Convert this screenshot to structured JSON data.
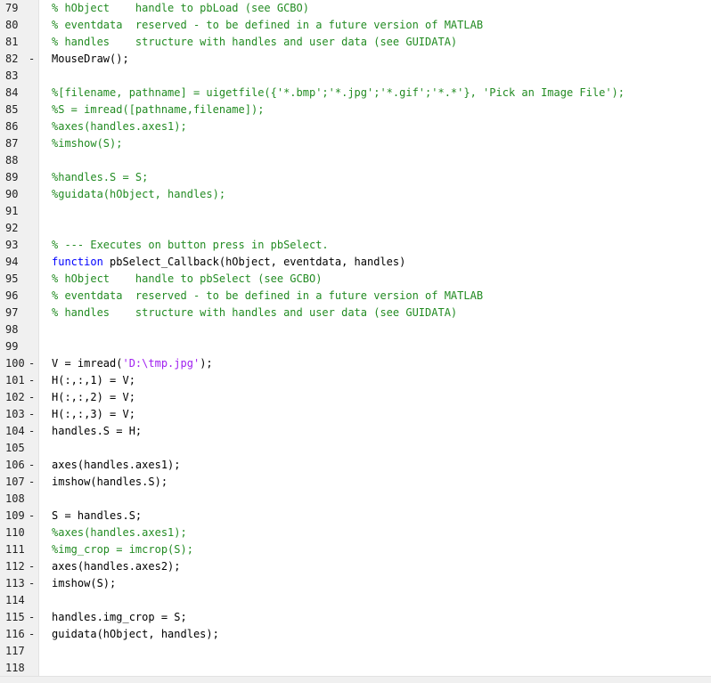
{
  "editor": {
    "colors": {
      "comment": "#228B22",
      "keyword": "#0000FF",
      "string": "#A020F0",
      "text": "#000000",
      "gutter": "#F0F0F0"
    },
    "lines": [
      {
        "num": "79",
        "marker": "",
        "tokens": [
          {
            "t": "comment",
            "v": "% hObject    handle to pbLoad (see GCBO)"
          }
        ]
      },
      {
        "num": "80",
        "marker": "",
        "tokens": [
          {
            "t": "comment",
            "v": "% eventdata  reserved - to be defined in a future version of MATLAB"
          }
        ]
      },
      {
        "num": "81",
        "marker": "",
        "tokens": [
          {
            "t": "comment",
            "v": "% handles    structure with handles and user data (see GUIDATA)"
          }
        ]
      },
      {
        "num": "82",
        "marker": "-",
        "tokens": [
          {
            "t": "text",
            "v": "MouseDraw();"
          }
        ]
      },
      {
        "num": "83",
        "marker": "",
        "tokens": []
      },
      {
        "num": "84",
        "marker": "",
        "tokens": [
          {
            "t": "comment",
            "v": "%[filename, pathname] = uigetfile({'*.bmp';'*.jpg';'*.gif';'*.*'}, 'Pick an Image File');"
          }
        ]
      },
      {
        "num": "85",
        "marker": "",
        "tokens": [
          {
            "t": "comment",
            "v": "%S = imread([pathname,filename]);"
          }
        ]
      },
      {
        "num": "86",
        "marker": "",
        "tokens": [
          {
            "t": "comment",
            "v": "%axes(handles.axes1);"
          }
        ]
      },
      {
        "num": "87",
        "marker": "",
        "tokens": [
          {
            "t": "comment",
            "v": "%imshow(S);"
          }
        ]
      },
      {
        "num": "88",
        "marker": "",
        "tokens": []
      },
      {
        "num": "89",
        "marker": "",
        "tokens": [
          {
            "t": "comment",
            "v": "%handles.S = S;"
          }
        ]
      },
      {
        "num": "90",
        "marker": "",
        "tokens": [
          {
            "t": "comment",
            "v": "%guidata(hObject, handles);"
          }
        ]
      },
      {
        "num": "91",
        "marker": "",
        "tokens": []
      },
      {
        "num": "92",
        "marker": "",
        "tokens": []
      },
      {
        "num": "93",
        "marker": "",
        "tokens": [
          {
            "t": "comment",
            "v": "% --- Executes on button press in pbSelect."
          }
        ]
      },
      {
        "num": "94",
        "marker": "",
        "tokens": [
          {
            "t": "keyword",
            "v": "function"
          },
          {
            "t": "text",
            "v": " pbSelect_Callback(hObject, eventdata, handles)"
          }
        ]
      },
      {
        "num": "95",
        "marker": "",
        "tokens": [
          {
            "t": "comment",
            "v": "% hObject    handle to pbSelect (see GCBO)"
          }
        ]
      },
      {
        "num": "96",
        "marker": "",
        "tokens": [
          {
            "t": "comment",
            "v": "% eventdata  reserved - to be defined in a future version of MATLAB"
          }
        ]
      },
      {
        "num": "97",
        "marker": "",
        "tokens": [
          {
            "t": "comment",
            "v": "% handles    structure with handles and user data (see GUIDATA)"
          }
        ]
      },
      {
        "num": "98",
        "marker": "",
        "tokens": []
      },
      {
        "num": "99",
        "marker": "",
        "tokens": []
      },
      {
        "num": "100",
        "marker": "-",
        "tokens": [
          {
            "t": "text",
            "v": "V = imread("
          },
          {
            "t": "string",
            "v": "'D:\\tmp.jpg'"
          },
          {
            "t": "text",
            "v": ");"
          }
        ]
      },
      {
        "num": "101",
        "marker": "-",
        "tokens": [
          {
            "t": "text",
            "v": "H(:,:,1) = V;"
          }
        ]
      },
      {
        "num": "102",
        "marker": "-",
        "tokens": [
          {
            "t": "text",
            "v": "H(:,:,2) = V;"
          }
        ]
      },
      {
        "num": "103",
        "marker": "-",
        "tokens": [
          {
            "t": "text",
            "v": "H(:,:,3) = V;"
          }
        ]
      },
      {
        "num": "104",
        "marker": "-",
        "tokens": [
          {
            "t": "text",
            "v": "handles.S = H;"
          }
        ]
      },
      {
        "num": "105",
        "marker": "",
        "tokens": []
      },
      {
        "num": "106",
        "marker": "-",
        "tokens": [
          {
            "t": "text",
            "v": "axes(handles.axes1);"
          }
        ]
      },
      {
        "num": "107",
        "marker": "-",
        "tokens": [
          {
            "t": "text",
            "v": "imshow(handles.S);"
          }
        ]
      },
      {
        "num": "108",
        "marker": "",
        "tokens": []
      },
      {
        "num": "109",
        "marker": "-",
        "tokens": [
          {
            "t": "text",
            "v": "S = handles.S;"
          }
        ]
      },
      {
        "num": "110",
        "marker": "",
        "tokens": [
          {
            "t": "comment",
            "v": "%axes(handles.axes1);"
          }
        ]
      },
      {
        "num": "111",
        "marker": "",
        "tokens": [
          {
            "t": "comment",
            "v": "%img_crop = imcrop(S);"
          }
        ]
      },
      {
        "num": "112",
        "marker": "-",
        "tokens": [
          {
            "t": "text",
            "v": "axes(handles.axes2);"
          }
        ]
      },
      {
        "num": "113",
        "marker": "-",
        "tokens": [
          {
            "t": "text",
            "v": "imshow(S);"
          }
        ]
      },
      {
        "num": "114",
        "marker": "",
        "tokens": []
      },
      {
        "num": "115",
        "marker": "-",
        "tokens": [
          {
            "t": "text",
            "v": "handles.img_crop = S;"
          }
        ]
      },
      {
        "num": "116",
        "marker": "-",
        "tokens": [
          {
            "t": "text",
            "v": "guidata(hObject, handles);"
          }
        ]
      },
      {
        "num": "117",
        "marker": "",
        "tokens": []
      },
      {
        "num": "118",
        "marker": "",
        "tokens": []
      }
    ]
  }
}
